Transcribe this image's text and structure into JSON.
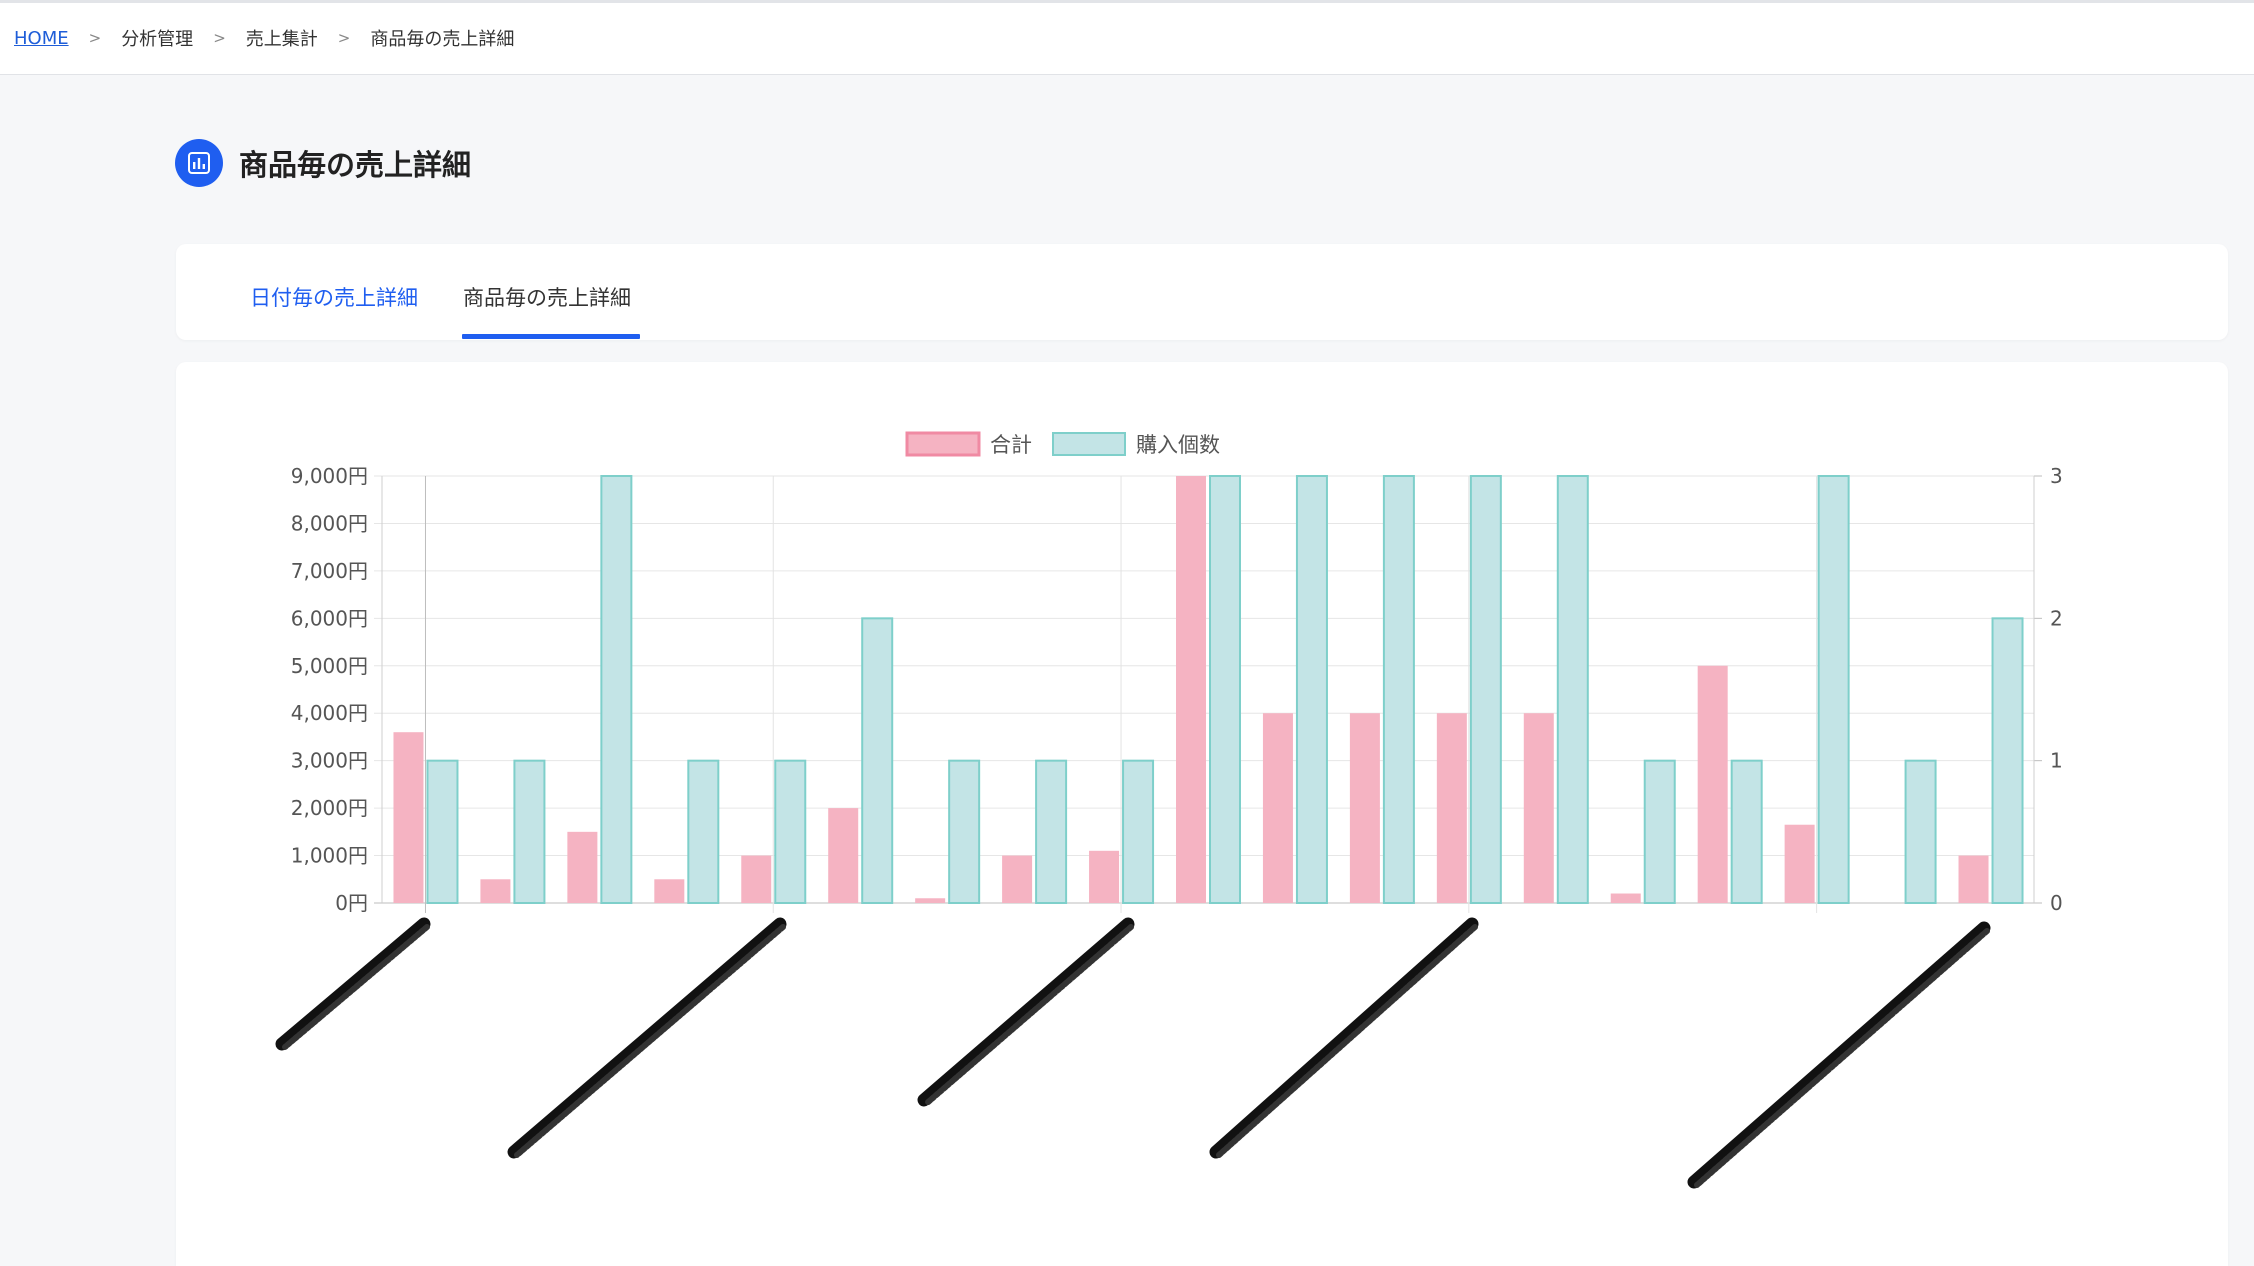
{
  "breadcrumb": {
    "home": "HOME",
    "separator": ">",
    "level1": "分析管理",
    "level2": "売上集計",
    "level3": "商品毎の売上詳細"
  },
  "page": {
    "title": "商品毎の売上詳細",
    "icon": "bar-chart-icon"
  },
  "tabs": [
    {
      "label": "日付毎の売上詳細",
      "active": false
    },
    {
      "label": "商品毎の売上詳細",
      "active": true
    }
  ],
  "colors": {
    "accent": "#1f5ef0",
    "sales_fill": "#f5b3c2",
    "sales_border": "#f08aa3",
    "count_fill": "#c3e4e6",
    "count_border": "#7ecfca"
  },
  "chart_data": {
    "type": "bar",
    "series": [
      {
        "name": "合計",
        "axis": "left",
        "values": [
          3600,
          500,
          1500,
          500,
          1000,
          2000,
          100,
          1000,
          1100,
          9000,
          4000,
          4000,
          4000,
          4000,
          200,
          5000,
          1650,
          0,
          1000
        ]
      },
      {
        "name": "購入個数",
        "axis": "right",
        "values": [
          1,
          1,
          3,
          1,
          1,
          2,
          1,
          1,
          1,
          3,
          3,
          3,
          3,
          3,
          1,
          1,
          3,
          1,
          2
        ]
      }
    ],
    "left_axis": {
      "min": 0,
      "max": 9000,
      "ticks": [
        "0円",
        "1,000円",
        "2,000円",
        "3,000円",
        "4,000円",
        "5,000円",
        "6,000円",
        "7,000円",
        "8,000円",
        "9,000円"
      ]
    },
    "right_axis": {
      "min": 0,
      "max": 3,
      "ticks": [
        "0",
        "1",
        "2",
        "3"
      ]
    },
    "x_label_note": "category labels redacted (scribbled out)",
    "grid": true,
    "legend_position": "top-center"
  }
}
